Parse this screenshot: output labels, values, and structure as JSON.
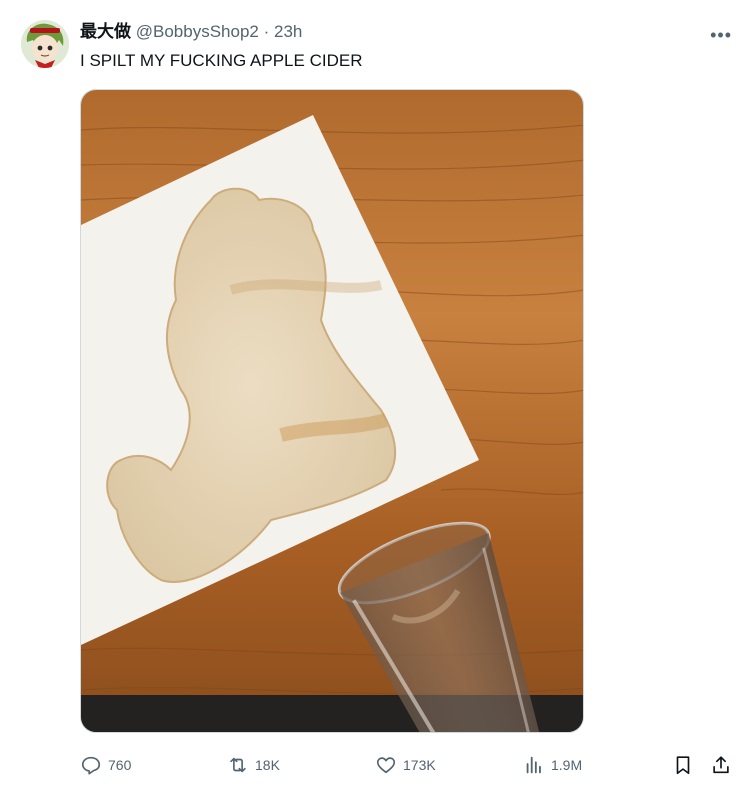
{
  "author": {
    "display_name": "最大做",
    "handle": "@BobbysShop2",
    "separator": "·",
    "time": "23h"
  },
  "tweet": {
    "text": "I SPILT MY FUCKING APPLE CIDER"
  },
  "actions": {
    "reply_count": "760",
    "retweet_count": "18K",
    "like_count": "173K",
    "views_count": "1.9M"
  },
  "icons": {
    "more": "more-icon",
    "reply": "reply-icon",
    "retweet": "retweet-icon",
    "like": "heart-icon",
    "views": "analytics-icon",
    "bookmark": "bookmark-icon",
    "share": "share-icon"
  },
  "colors": {
    "text_primary": "#0f1419",
    "text_secondary": "#536471",
    "border": "#cfd9de"
  }
}
